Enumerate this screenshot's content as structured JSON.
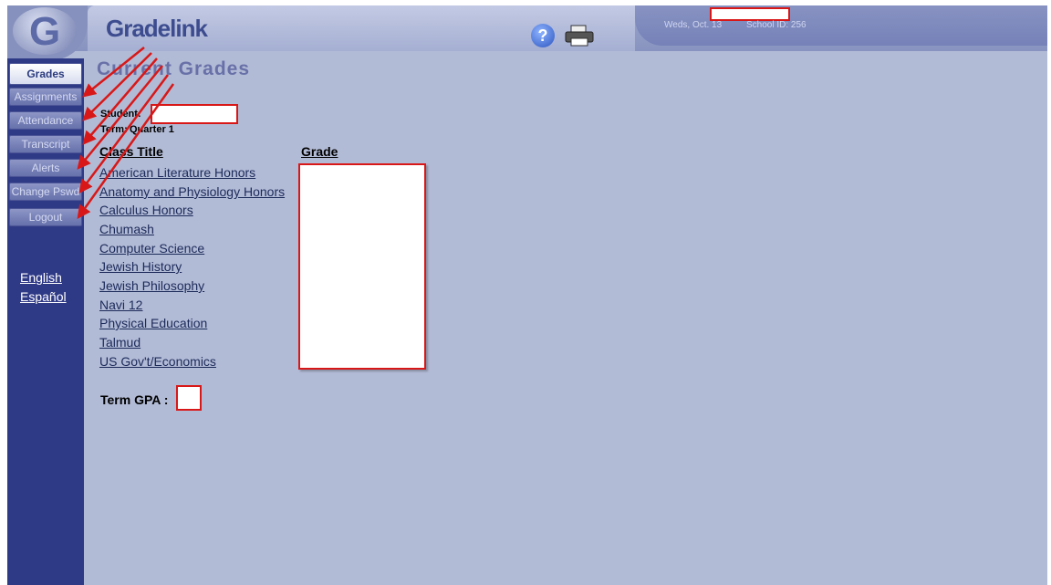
{
  "header": {
    "brand": "Gradelink",
    "date": "Weds, Oct. 13",
    "school_id": "School ID: 256"
  },
  "sidebar": {
    "items": [
      {
        "label": "Grades",
        "active": true
      },
      {
        "label": "Assignments"
      },
      {
        "label": "Attendance"
      },
      {
        "label": "Transcript"
      },
      {
        "label": "Alerts"
      },
      {
        "label": "Change Pswd"
      },
      {
        "label": "Logout"
      }
    ],
    "languages": [
      "English",
      "Español"
    ]
  },
  "main": {
    "title": "Current Grades",
    "student_label": "Student:",
    "term_label": "Term:",
    "term_value": "Quarter 1",
    "columns": [
      "Class Title",
      "Grade"
    ],
    "classes": [
      "American Literature Honors",
      "Anatomy and Physiology Honors",
      "Calculus Honors",
      "Chumash",
      "Computer Science",
      "Jewish History",
      "Jewish Philosophy",
      "Navi 12",
      "Physical Education",
      "Talmud",
      "US Gov't/Economics"
    ],
    "gpa_label": "Term GPA :"
  },
  "colors": {
    "background": "#b2bbd6",
    "sidebar": "#2f3a87",
    "annotation": "#d81818",
    "link": "#1c2a5a"
  }
}
